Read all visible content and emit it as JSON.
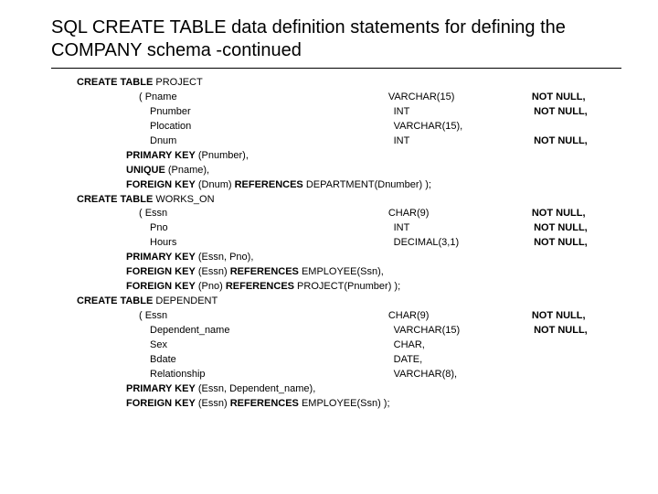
{
  "title": "SQL CREATE TABLE data definition statements for defining the COMPANY schema -continued",
  "t1": {
    "create": "CREATE TABLE",
    "name": "PROJECT",
    "cols": [
      {
        "n": "Pname",
        "t": "VARCHAR(15)",
        "c": "NOT NULL,",
        "open": true
      },
      {
        "n": "Pnumber",
        "t": "INT",
        "c": "NOT NULL,"
      },
      {
        "n": "Plocation",
        "t": "VARCHAR(15),",
        "c": ""
      },
      {
        "n": "Dnum",
        "t": "INT",
        "c": "NOT NULL,"
      }
    ],
    "keys": [
      {
        "kw": "PRIMARY KEY",
        "body": "(Pnumber),"
      },
      {
        "kw": "UNIQUE",
        "body": "(Pname),"
      },
      {
        "kw": "FOREIGN KEY",
        "body": "(Dnum)",
        "kw2": "REFERENCES",
        "body2": "DEPARTMENT(Dnumber) );"
      }
    ]
  },
  "t2": {
    "create": "CREATE TABLE",
    "name": "WORKS_ON",
    "cols": [
      {
        "n": "Essn",
        "t": "CHAR(9)",
        "c": "NOT NULL,",
        "open": true
      },
      {
        "n": "Pno",
        "t": "INT",
        "c": "NOT NULL,"
      },
      {
        "n": "Hours",
        "t": "DECIMAL(3,1)",
        "c": "NOT NULL,"
      }
    ],
    "keys": [
      {
        "kw": "PRIMARY KEY",
        "body": "(Essn, Pno),"
      },
      {
        "kw": "FOREIGN KEY",
        "body": "(Essn)",
        "kw2": "REFERENCES",
        "body2": "EMPLOYEE(Ssn),"
      },
      {
        "kw": "FOREIGN KEY",
        "body": "(Pno)",
        "kw2": "REFERENCES",
        "body2": "PROJECT(Pnumber) );"
      }
    ]
  },
  "t3": {
    "create": "CREATE TABLE",
    "name": "DEPENDENT",
    "cols": [
      {
        "n": "Essn",
        "t": "CHAR(9)",
        "c": "NOT NULL,",
        "open": true
      },
      {
        "n": "Dependent_name",
        "t": "VARCHAR(15)",
        "c": "NOT NULL,"
      },
      {
        "n": "Sex",
        "t": "CHAR,",
        "c": ""
      },
      {
        "n": "Bdate",
        "t": "DATE,",
        "c": ""
      },
      {
        "n": "Relationship",
        "t": "VARCHAR(8),",
        "c": ""
      }
    ],
    "keys": [
      {
        "kw": "PRIMARY KEY",
        "body": "(Essn, Dependent_name),"
      },
      {
        "kw": "FOREIGN KEY",
        "body": "(Essn)",
        "kw2": "REFERENCES",
        "body2": "EMPLOYEE(Ssn) );"
      }
    ]
  }
}
